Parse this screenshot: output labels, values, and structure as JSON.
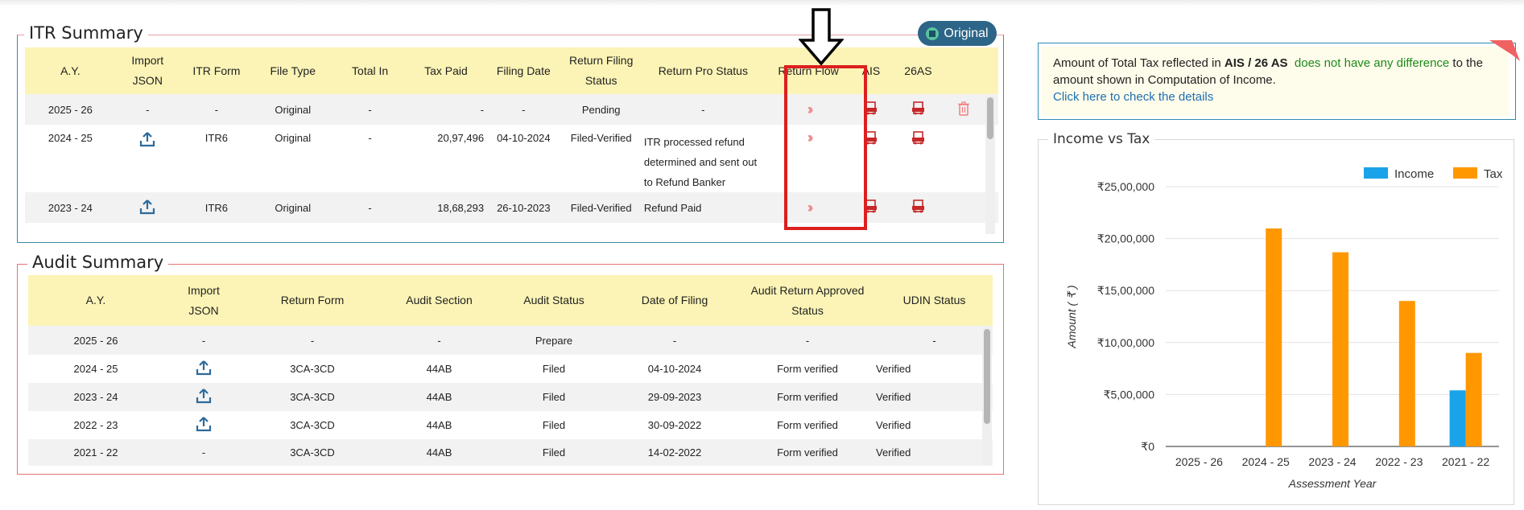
{
  "original_badge": "Original",
  "itr": {
    "legend": "ITR Summary",
    "headers": {
      "ay": "A.Y.",
      "import_top": "Import",
      "import_bottom": "JSON",
      "itr_form": "ITR Form",
      "file_type": "File Type",
      "total_in": "Total In",
      "tax_paid": "Tax Paid",
      "filing_date": "Filing Date",
      "rf_top": "Return Filing",
      "rf_bottom": "Status",
      "return_pro_status": "Return Pro Status",
      "return_flow": "Return Flow",
      "ais": "AIS",
      "as26": "26AS"
    },
    "rows": [
      {
        "ay": "2025 - 26",
        "import": "-",
        "form": "-",
        "file_type": "Original",
        "total_in": "-",
        "tax_paid": "-",
        "filing_date": "-",
        "status": "Pending",
        "pro_status": "-"
      },
      {
        "ay": "2024 - 25",
        "import": "upload-icon",
        "form": "ITR6",
        "file_type": "Original",
        "total_in": "-",
        "tax_paid": "20,97,496",
        "filing_date": "04-10-2024",
        "status": "Filed-Verified",
        "pro_status_lines": [
          "ITR processed refund",
          "determined and sent out",
          "to Refund Banker"
        ]
      },
      {
        "ay": "2023 - 24",
        "import": "upload-icon",
        "form": "ITR6",
        "file_type": "Original",
        "total_in": "-",
        "tax_paid": "18,68,293",
        "filing_date": "26-10-2023",
        "status": "Filed-Verified",
        "pro_status": "Refund Paid"
      }
    ]
  },
  "audit": {
    "legend": "Audit Summary",
    "headers": {
      "ay": "A.Y.",
      "import_top": "Import",
      "import_bottom": "JSON",
      "return_form": "Return Form",
      "audit_section": "Audit Section",
      "audit_status": "Audit Status",
      "date_of_filing": "Date of Filing",
      "ara_top": "Audit Return Approved",
      "ara_bottom": "Status",
      "udin": "UDIN Status"
    },
    "rows": [
      {
        "ay": "2025 - 26",
        "import": "-",
        "form": "-",
        "section": "-",
        "status": "Prepare",
        "date": "-",
        "approved": "-",
        "udin": "-"
      },
      {
        "ay": "2024 - 25",
        "form": "3CA-3CD",
        "section": "44AB",
        "status": "Filed",
        "date": "04-10-2024",
        "approved": "Form verified",
        "udin": "Verified"
      },
      {
        "ay": "2023 - 24",
        "form": "3CA-3CD",
        "section": "44AB",
        "status": "Filed",
        "date": "29-09-2023",
        "approved": "Form verified",
        "udin": "Verified"
      },
      {
        "ay": "2022 - 23",
        "form": "3CA-3CD",
        "section": "44AB",
        "status": "Filed",
        "date": "30-09-2022",
        "approved": "Form verified",
        "udin": "Verified"
      },
      {
        "ay": "2021 - 22",
        "import": "-",
        "form": "3CA-3CD",
        "section": "44AB",
        "status": "Filed",
        "date": "14-02-2022",
        "approved": "Form verified",
        "udin": "Verified"
      }
    ]
  },
  "tax_note": {
    "part1": "Amount of Total Tax reflected in ",
    "bold": "AIS / 26 AS",
    "green": "does not have any difference",
    "part2": " to the amount shown in Computation of Income.",
    "link": "Click here to check the details"
  },
  "colors": {
    "income": "#1aa3e8",
    "tax": "#ff9800",
    "highlight": "#dc1f1f",
    "header_bg": "#fcf4b6"
  },
  "chart_data": {
    "type": "bar",
    "title": "Income vs Tax",
    "xlabel": "Assessment Year",
    "ylabel": "Amount ( ₹ )",
    "categories": [
      "2025 - 26",
      "2024 - 25",
      "2023 - 24",
      "2022 - 23",
      "2021 - 22"
    ],
    "series": [
      {
        "name": "Income",
        "values": [
          0,
          0,
          0,
          0,
          540000
        ]
      },
      {
        "name": "Tax",
        "values": [
          0,
          2097496,
          1868293,
          1400000,
          900000
        ]
      }
    ],
    "ylim": [
      0,
      2500000
    ],
    "yticks": [
      "₹0",
      "₹5,00,000",
      "₹10,00,000",
      "₹15,00,000",
      "₹20,00,000",
      "₹25,00,000"
    ],
    "legend": "top-right",
    "grid": true
  }
}
